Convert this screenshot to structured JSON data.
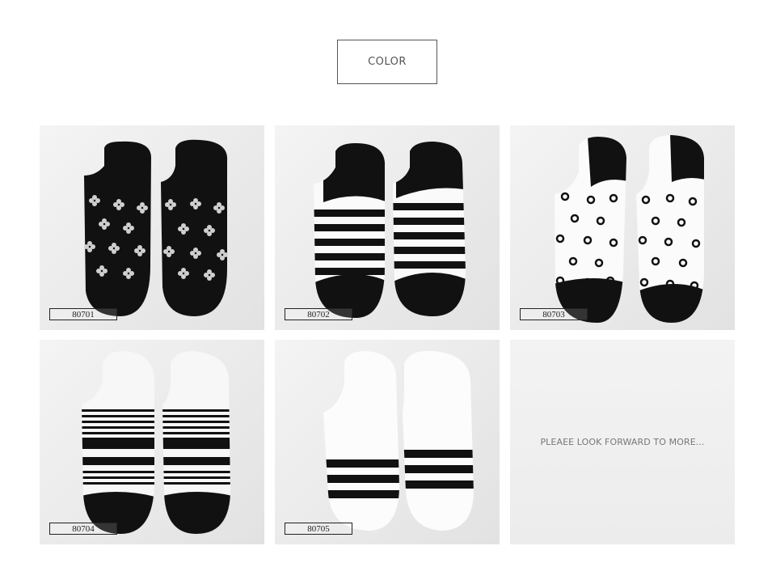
{
  "header": {
    "color_label": "COLOR"
  },
  "products": [
    {
      "code": "80701",
      "pattern": "flower-dots-black"
    },
    {
      "code": "80702",
      "pattern": "horizontal-stripes-white"
    },
    {
      "code": "80703",
      "pattern": "swirl-dots-white"
    },
    {
      "code": "80704",
      "pattern": "fine-stripes-white"
    },
    {
      "code": "80705",
      "pattern": "wide-stripes-white"
    }
  ],
  "placeholder": {
    "text": "PLEAEE LOOK FORWARD TO MORE..."
  },
  "colors": {
    "sock_black": "#111111",
    "sock_white": "#fafafa",
    "background": "#ececec"
  }
}
